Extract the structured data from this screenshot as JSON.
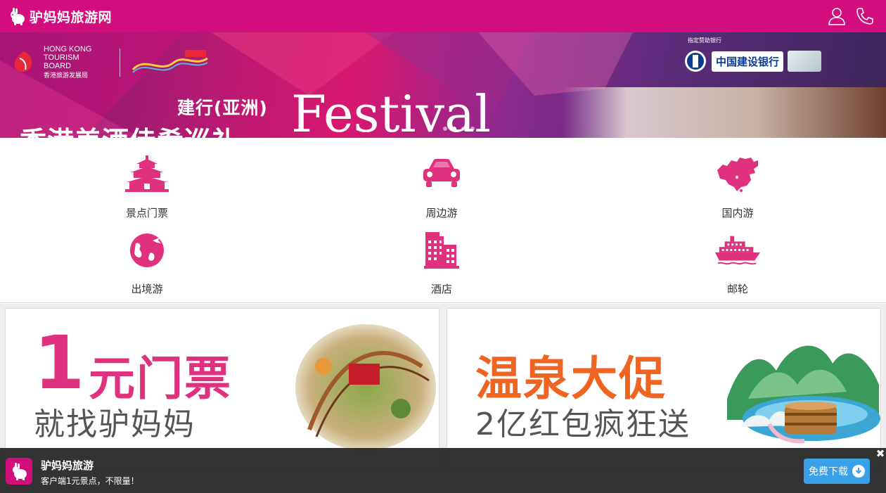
{
  "header": {
    "title": "驴妈妈旅游网",
    "actions": [
      {
        "name": "user-icon"
      },
      {
        "name": "phone-icon"
      }
    ]
  },
  "banner": {
    "hk_logo_text": "HONG KONG TOURISM BOARD",
    "hk_logo_sub": "香港旅游发展局",
    "bank_caption": "指定赞助银行",
    "bank_name": "中国建设银行",
    "subtitle": "建行(亚洲)",
    "headline": "香港美酒佳肴巡礼",
    "festival": "Festival",
    "dot_count": 4,
    "active_dot": 1
  },
  "categories": [
    {
      "label": "景点门票",
      "icon": "temple-icon"
    },
    {
      "label": "周边游",
      "icon": "car-icon"
    },
    {
      "label": "国内游",
      "icon": "china-map-icon"
    },
    {
      "label": "出境游",
      "icon": "globe-icon"
    },
    {
      "label": "酒店",
      "icon": "hotel-icon"
    },
    {
      "label": "邮轮",
      "icon": "cruise-ship-icon"
    }
  ],
  "promos": [
    {
      "num": "1",
      "title": "元门票",
      "sub": "就找驴妈妈",
      "accent": "#e0317f"
    },
    {
      "num": "",
      "title": "温泉大促",
      "sub": "2亿红包疯狂送",
      "accent": "#f06422"
    }
  ],
  "app_bar": {
    "name": "驴妈妈旅游",
    "desc": "客户端1元景点，不限量！",
    "download": "免费下载",
    "close": "✖"
  },
  "colors": {
    "brand": "#d30d7c",
    "icon": "#e0317f",
    "download": "#3aa0e8"
  }
}
